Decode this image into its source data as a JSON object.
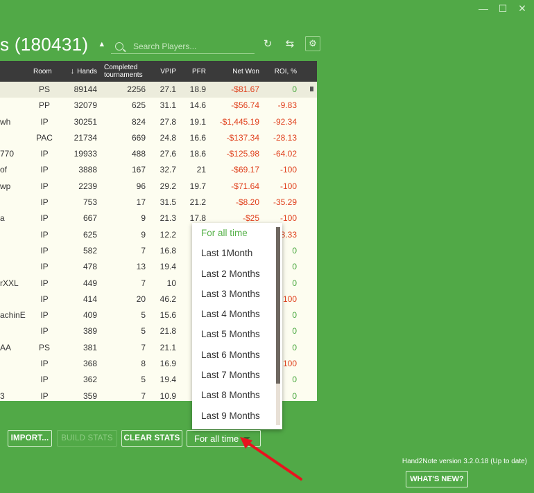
{
  "window": {
    "controls": [
      "—",
      "☐",
      "✕"
    ]
  },
  "header": {
    "title": "s (180431)",
    "search_placeholder": "Search Players..."
  },
  "table": {
    "columns": {
      "room": "Room",
      "hands": "Hands",
      "completed_line1": "Completed",
      "completed_line2": "tournaments",
      "vpip": "VPIP",
      "pfr": "PFR",
      "net_won": "Net Won",
      "roi": "ROI, %"
    },
    "rows": [
      {
        "name": "",
        "room": "PS",
        "hands": "89144",
        "completed": "2256",
        "vpip": "27.1",
        "pfr": "18.9",
        "net_won": "-$81.67",
        "roi": "0"
      },
      {
        "name": "",
        "room": "PP",
        "hands": "32079",
        "completed": "625",
        "vpip": "31.1",
        "pfr": "14.6",
        "net_won": "-$56.74",
        "roi": "-9.83"
      },
      {
        "name": "wh",
        "room": "IP",
        "hands": "30251",
        "completed": "824",
        "vpip": "27.8",
        "pfr": "19.1",
        "net_won": "-$1,445.19",
        "roi": "-92.34"
      },
      {
        "name": "",
        "room": "PAC",
        "hands": "21734",
        "completed": "669",
        "vpip": "24.8",
        "pfr": "16.6",
        "net_won": "-$137.34",
        "roi": "-28.13"
      },
      {
        "name": "770",
        "room": "IP",
        "hands": "19933",
        "completed": "488",
        "vpip": "27.6",
        "pfr": "18.6",
        "net_won": "-$125.98",
        "roi": "-64.02"
      },
      {
        "name": "of",
        "room": "IP",
        "hands": "3888",
        "completed": "167",
        "vpip": "32.7",
        "pfr": "21",
        "net_won": "-$69.17",
        "roi": "-100"
      },
      {
        "name": "wp",
        "room": "IP",
        "hands": "2239",
        "completed": "96",
        "vpip": "29.2",
        "pfr": "19.7",
        "net_won": "-$71.64",
        "roi": "-100"
      },
      {
        "name": "",
        "room": "IP",
        "hands": "753",
        "completed": "17",
        "vpip": "31.5",
        "pfr": "21.2",
        "net_won": "-$8.20",
        "roi": "-35.29"
      },
      {
        "name": "a",
        "room": "IP",
        "hands": "667",
        "completed": "9",
        "vpip": "21.3",
        "pfr": "17.8",
        "net_won": "-$25",
        "roi": "-100"
      },
      {
        "name": "",
        "room": "IP",
        "hands": "625",
        "completed": "9",
        "vpip": "12.2",
        "pfr": "",
        "net_won": "",
        "roi": "3.33"
      },
      {
        "name": "",
        "room": "IP",
        "hands": "582",
        "completed": "7",
        "vpip": "16.8",
        "pfr": "",
        "net_won": "",
        "roi": "0"
      },
      {
        "name": "",
        "room": "IP",
        "hands": "478",
        "completed": "13",
        "vpip": "19.4",
        "pfr": "",
        "net_won": "",
        "roi": "0"
      },
      {
        "name": "rXXL",
        "room": "IP",
        "hands": "449",
        "completed": "7",
        "vpip": "10",
        "pfr": "",
        "net_won": "",
        "roi": "0"
      },
      {
        "name": "",
        "room": "IP",
        "hands": "414",
        "completed": "20",
        "vpip": "46.2",
        "pfr": "",
        "net_won": "",
        "roi": "100"
      },
      {
        "name": "achinE",
        "room": "IP",
        "hands": "409",
        "completed": "5",
        "vpip": "15.6",
        "pfr": "",
        "net_won": "",
        "roi": "0"
      },
      {
        "name": "",
        "room": "IP",
        "hands": "389",
        "completed": "5",
        "vpip": "21.8",
        "pfr": "",
        "net_won": "",
        "roi": "0"
      },
      {
        "name": "AA",
        "room": "PS",
        "hands": "381",
        "completed": "7",
        "vpip": "21.1",
        "pfr": "",
        "net_won": "",
        "roi": "0"
      },
      {
        "name": "",
        "room": "IP",
        "hands": "368",
        "completed": "8",
        "vpip": "16.9",
        "pfr": "",
        "net_won": "",
        "roi": "100"
      },
      {
        "name": "",
        "room": "IP",
        "hands": "362",
        "completed": "5",
        "vpip": "19.4",
        "pfr": "",
        "net_won": "",
        "roi": "0"
      },
      {
        "name": "3",
        "room": "IP",
        "hands": "359",
        "completed": "7",
        "vpip": "10.9",
        "pfr": "",
        "net_won": "",
        "roi": "0"
      }
    ]
  },
  "dropdown": {
    "options": [
      "For all time",
      "Last 1Month",
      "Last 2 Months",
      "Last 3 Months",
      "Last 4 Months",
      "Last 5 Months",
      "Last 6 Months",
      "Last 7 Months",
      "Last 8 Months",
      "Last 9 Months"
    ],
    "active_index": 0
  },
  "footer": {
    "import_label": "IMPORT...",
    "build_stats_label": "BUILD STATS",
    "clear_stats_label": "CLEAR STATS",
    "time_filter_value": "For all time",
    "version_text": "Hand2Note version 3.2.0.18 (Up to date)",
    "whats_new_label": "WHAT'S NEW?"
  },
  "colors": {
    "background": "#51a947",
    "negative": "#e0401c",
    "positive": "#4aa83f",
    "header": "#3a3a3a",
    "arrow": "#e8141e"
  }
}
